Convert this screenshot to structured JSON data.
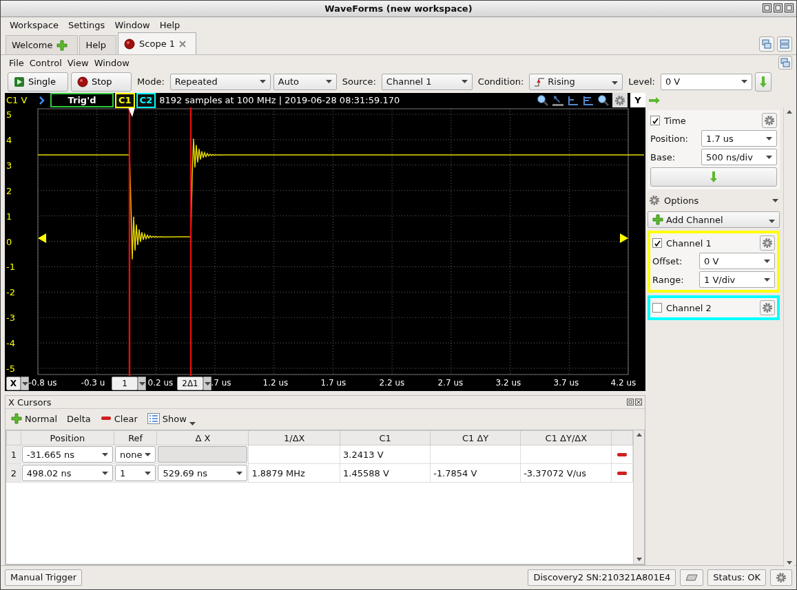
{
  "window": {
    "title": "WaveForms (new workspace)"
  },
  "menu": [
    "Workspace",
    "Settings",
    "Window",
    "Help"
  ],
  "tabs": [
    {
      "label": "Welcome",
      "kind": "add",
      "selected": false
    },
    {
      "label": "Help",
      "kind": "plain",
      "selected": false
    },
    {
      "label": "Scope 1",
      "kind": "closable",
      "selected": true
    }
  ],
  "scope_menu": [
    "File",
    "Control",
    "View",
    "Window"
  ],
  "toolbar": {
    "single": "Single",
    "stop": "Stop",
    "mode_label": "Mode:",
    "mode": "Repeated",
    "auto": "Auto",
    "source_label": "Source:",
    "source": "Channel 1",
    "condition_label": "Condition:",
    "condition": "Rising",
    "level_label": "Level:",
    "level": "0 V"
  },
  "plot": {
    "axis_label": "C1 V",
    "status": "Trig'd",
    "channel_tags": [
      {
        "label": "C1",
        "color": "#ffff00"
      },
      {
        "label": "C2",
        "color": "#00ffff"
      }
    ],
    "info": "8192 samples at 100 MHz | 2019-06-28 08:31:59.170",
    "y_button": "Y",
    "y_ticks": [
      "5",
      "4",
      "3",
      "2",
      "1",
      "0",
      "-1",
      "-2",
      "-3",
      "-4",
      "-5"
    ],
    "x_button": "X",
    "x_ticks": [
      "-0.8 us",
      "-0.3 u",
      "0.2 us",
      ".7 us",
      "1.2 us",
      "1.7 us",
      "2.2 us",
      "2.7 us",
      "3.2 us",
      "3.7 us",
      "4.2 us"
    ],
    "cursors": [
      {
        "label": "1"
      },
      {
        "label": "2Δ1"
      }
    ]
  },
  "side": {
    "time": {
      "label": "Time",
      "checked": true,
      "position_label": "Position:",
      "position": "1.7 us",
      "base_label": "Base:",
      "base": "500 ns/div"
    },
    "options": "Options",
    "add_channel": "Add Channel",
    "channels": [
      {
        "label": "Channel 1",
        "checked": true,
        "color": "#ffff00",
        "offset_label": "Offset:",
        "offset": "0 V",
        "range_label": "Range:",
        "range": "1 V/div"
      },
      {
        "label": "Channel 2",
        "checked": false,
        "color": "#00ffff"
      }
    ]
  },
  "cursors_panel": {
    "title": "X Cursors",
    "tools": [
      {
        "label": "Normal",
        "kind": "add"
      },
      {
        "label": "Delta",
        "kind": "plain"
      },
      {
        "label": "Clear",
        "kind": "remove"
      },
      {
        "label": "Show",
        "kind": "menu"
      }
    ],
    "columns": [
      "Position",
      "Ref",
      "Δ X",
      "1/ΔX",
      "C1",
      "C1 ΔY",
      "C1 ΔY/ΔX"
    ],
    "rows": [
      {
        "index": "1",
        "position": "-31.665 ns",
        "ref": "none",
        "delta_x": {
          "disabled": true
        },
        "c1": "3.2413 V"
      },
      {
        "index": "2",
        "position": "498.02 ns",
        "ref": "1",
        "delta_x": {
          "value": "529.69 ns",
          "disabled": false
        },
        "inv_dx": "1.8879 MHz",
        "c1": "1.45588 V",
        "c1_dy": "-1.7854 V",
        "c1_slope": "-3.37072 V/us"
      }
    ]
  },
  "status_bar": {
    "manual_trigger": "Manual Trigger",
    "device": "Discovery2 SN:210321A801E4",
    "status": "Status: OK"
  }
}
